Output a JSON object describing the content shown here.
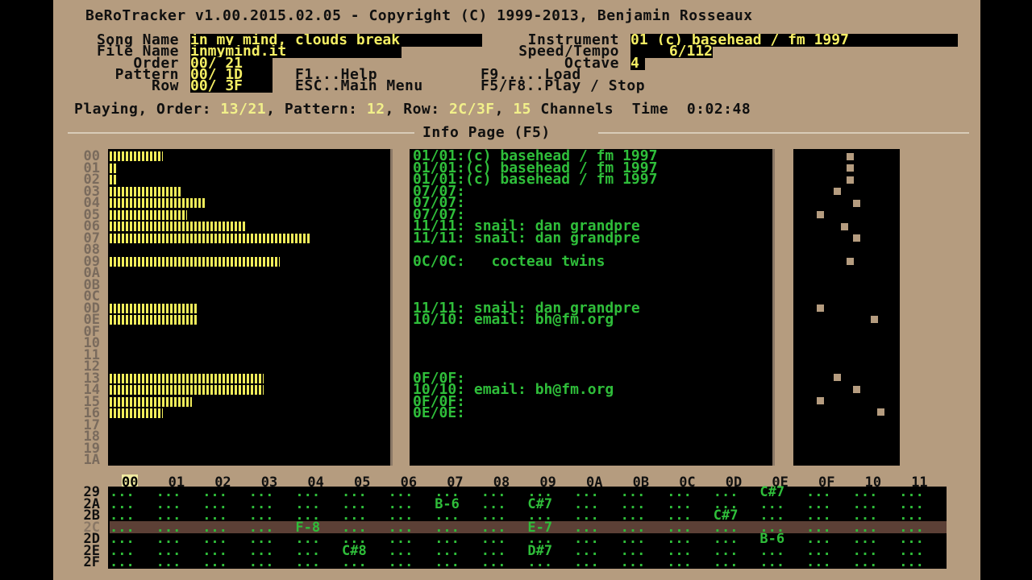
{
  "title": "BeRoTracker v1.00.2015.02.05 - Copyright (C) 1999-2013, Benjamin Rosseaux",
  "fields": {
    "song_name_label": "Song Name",
    "song_name": "in my mind, clouds break",
    "file_name_label": "File Name",
    "file_name": "inmymind.it",
    "order_label": "Order",
    "order_value": "00/ 21",
    "pattern_label": "Pattern",
    "pattern_value": "00/ 1D",
    "row_label": "Row",
    "row_value": "00/ 3F",
    "instrument_label": "Instrument",
    "instrument_value": "01 (c) basehead / fm 1997",
    "speed_label": "Speed/Tempo",
    "speed_value": "6/112",
    "octave_label": "Octave",
    "octave_value": "4"
  },
  "menu": {
    "help": "F1...Help",
    "main_menu": "ESC..Main Menu",
    "load": "F9.....Load",
    "play_stop": "F5/F8..Play / Stop"
  },
  "status": {
    "playing_label": "Playing, Order:",
    "order_cur": "13",
    "order_total": "21",
    "pattern_label": "Pattern:",
    "pattern_cur": "12",
    "row_label": "Row:",
    "row_cur": "2C",
    "row_total": "3F",
    "channels_num": "15",
    "channels_label": "Channels",
    "time_label": "Time",
    "time_value": "0:02:48"
  },
  "info_page_title": "Info Page (F5)",
  "channels": [
    "00",
    "01",
    "02",
    "03",
    "04",
    "05",
    "06",
    "07",
    "08",
    "09",
    "0A",
    "0B",
    "0C",
    "0D",
    "0E",
    "0F",
    "10",
    "11",
    "12",
    "13",
    "14",
    "15",
    "16",
    "17",
    "18",
    "19",
    "1A"
  ],
  "vu_levels": [
    0.2,
    0.03,
    0.03,
    0.27,
    0.36,
    0.29,
    0.51,
    0.75,
    0,
    0.64,
    0,
    0,
    0,
    0.33,
    0.33,
    0,
    0,
    0,
    0,
    0.58,
    0.58,
    0.31,
    0.2,
    0,
    0,
    0,
    0
  ],
  "info_lines": [
    "01/01:(c) basehead / fm 1997",
    "01/01:(c) basehead / fm 1997",
    "01/01:(c) basehead / fm 1997",
    "07/07:",
    "07/07:",
    "07/07:",
    "11/11: snail: dan grandpre",
    "11/11: snail: dan grandpre",
    "",
    "0C/0C:   cocteau twins",
    "",
    "",
    "",
    "11/11: snail: dan grandpre",
    "10/10: email: bh@fm.org",
    "",
    "",
    "",
    "",
    "0F/0F:",
    "10/10: email: bh@fm.org",
    "0F/0F:",
    "0E/0E:"
  ],
  "pattern": {
    "columns": [
      "00",
      "01",
      "02",
      "03",
      "04",
      "05",
      "06",
      "07",
      "08",
      "09",
      "0A",
      "0B",
      "0C",
      "0D",
      "0E",
      "0F",
      "10",
      "11"
    ],
    "selected_column": "00",
    "rows": [
      "29",
      "2A",
      "2B",
      "2C",
      "2D",
      "2E",
      "2F"
    ],
    "current_row": "2C",
    "empty_cell": "...",
    "notes": [
      {
        "row": "29",
        "col": 14,
        "text": "C#7"
      },
      {
        "row": "2A",
        "col": 7,
        "text": "B-6"
      },
      {
        "row": "2A",
        "col": 9,
        "text": "C#7"
      },
      {
        "row": "2B",
        "col": 13,
        "text": "C#7"
      },
      {
        "row": "2C",
        "col": 4,
        "text": "F-8"
      },
      {
        "row": "2C",
        "col": 9,
        "text": "E-7"
      },
      {
        "row": "2D",
        "col": 14,
        "text": "B-6"
      },
      {
        "row": "2E",
        "col": 5,
        "text": "C#8"
      },
      {
        "row": "2E",
        "col": 9,
        "text": "D#7"
      }
    ]
  },
  "colors": {
    "background": "#b59c7f",
    "panel": "#000000",
    "vu_bar": "#f0ec5a",
    "info_text": "#2fbe3a",
    "highlight_row": "#5c4036",
    "field_text": "#f4ee64"
  }
}
